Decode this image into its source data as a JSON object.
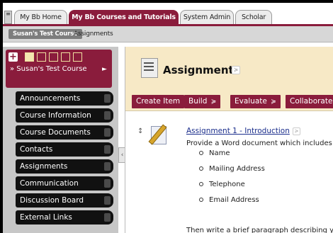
{
  "tabs": {
    "toggle_icon": "tabs-toggle-icon",
    "items": [
      {
        "label": "My Bb Home"
      },
      {
        "label": "My Bb Courses and Tutorials"
      },
      {
        "label": "System Admin"
      },
      {
        "label": "Scholar"
      }
    ],
    "active_index": 1
  },
  "breadcrumb": {
    "course": "Susan's Test Course",
    "page": "Assignments"
  },
  "sidebar": {
    "add_button": "+",
    "course_title": "» Susan's Test Course",
    "items": [
      {
        "label": "Announcements"
      },
      {
        "label": "Course Information"
      },
      {
        "label": "Course Documents"
      },
      {
        "label": "Contacts"
      },
      {
        "label": "Assignments"
      },
      {
        "label": "Communication"
      },
      {
        "label": "Discussion Board"
      },
      {
        "label": "External Links"
      }
    ],
    "collapse_icon": "‹"
  },
  "content": {
    "title": "Assignments",
    "actions": [
      {
        "label": "Create Item",
        "chevron": ""
      },
      {
        "label": "Build",
        "chevron": "≽"
      },
      {
        "label": "Evaluate",
        "chevron": "≽"
      },
      {
        "label": "Collaborate",
        "chevron": ""
      }
    ],
    "item": {
      "title": "Assignment 1 - Introduction",
      "description": "Provide a Word document which includes the",
      "bullets": [
        "Name",
        "Mailing Address",
        "Telephone",
        "Email Address"
      ],
      "after_text": "Then write a brief paragraph describing yourse"
    }
  },
  "colors": {
    "accent": "#8a1c3c",
    "header_bg": "#f7e9c6",
    "link": "#1b2e8c"
  }
}
